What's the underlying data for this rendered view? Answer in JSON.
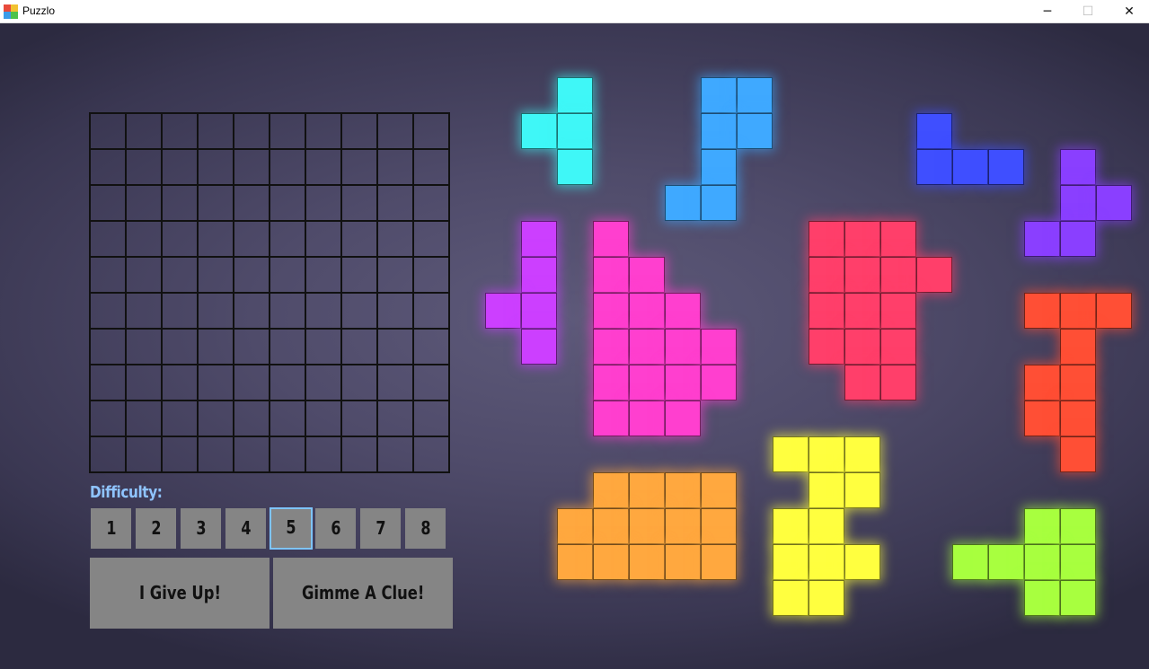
{
  "window": {
    "title": "Puzzlo",
    "minimize_glyph": "─",
    "maximize_glyph": "☐",
    "close_glyph": "✕",
    "icon": "puzzlo-app-icon"
  },
  "board": {
    "rows": 10,
    "cols": 10
  },
  "difficulty": {
    "label": "Difficulty:",
    "levels": [
      "1",
      "2",
      "3",
      "4",
      "5",
      "6",
      "7",
      "8"
    ],
    "selected": "5"
  },
  "actions": {
    "give_up": "I Give Up!",
    "clue": "Gimme A Clue!"
  },
  "colors": {
    "background": "#4f4b6a",
    "accent": "#8fc4ff",
    "button": "#858585"
  },
  "pieces": [
    {
      "name": "cyan",
      "color": "#3ff7f7",
      "cells": [
        [
          1,
          0
        ],
        [
          0,
          1
        ],
        [
          1,
          1
        ],
        [
          1,
          2
        ]
      ]
    },
    {
      "name": "sky-blue",
      "color": "#3fa9ff",
      "cells": [
        [
          1,
          0
        ],
        [
          2,
          0
        ],
        [
          1,
          1
        ],
        [
          2,
          1
        ],
        [
          1,
          2
        ],
        [
          0,
          3
        ],
        [
          1,
          3
        ]
      ]
    },
    {
      "name": "blue",
      "color": "#3f4fff",
      "cells": [
        [
          0,
          0
        ],
        [
          0,
          1
        ],
        [
          1,
          1
        ],
        [
          2,
          1
        ]
      ]
    },
    {
      "name": "violet",
      "color": "#8a3fff",
      "cells": [
        [
          1,
          0
        ],
        [
          1,
          1
        ],
        [
          2,
          1
        ],
        [
          0,
          2
        ],
        [
          1,
          2
        ]
      ]
    },
    {
      "name": "purple",
      "color": "#cc3fff",
      "cells": [
        [
          1,
          0
        ],
        [
          1,
          1
        ],
        [
          0,
          2
        ],
        [
          1,
          2
        ],
        [
          1,
          3
        ]
      ]
    },
    {
      "name": "magenta",
      "color": "#ff3fcf",
      "cells": [
        [
          0,
          0
        ],
        [
          0,
          1
        ],
        [
          1,
          1
        ],
        [
          0,
          2
        ],
        [
          1,
          2
        ],
        [
          2,
          2
        ],
        [
          0,
          3
        ],
        [
          1,
          3
        ],
        [
          2,
          3
        ],
        [
          3,
          3
        ],
        [
          0,
          4
        ],
        [
          1,
          4
        ],
        [
          2,
          4
        ],
        [
          3,
          4
        ],
        [
          0,
          5
        ],
        [
          1,
          5
        ],
        [
          2,
          5
        ]
      ]
    },
    {
      "name": "crimson",
      "color": "#ff3f6a",
      "cells": [
        [
          0,
          0
        ],
        [
          1,
          0
        ],
        [
          2,
          0
        ],
        [
          0,
          1
        ],
        [
          1,
          1
        ],
        [
          2,
          1
        ],
        [
          3,
          1
        ],
        [
          0,
          2
        ],
        [
          1,
          2
        ],
        [
          2,
          2
        ],
        [
          0,
          3
        ],
        [
          1,
          3
        ],
        [
          2,
          3
        ],
        [
          1,
          4
        ],
        [
          2,
          4
        ]
      ]
    },
    {
      "name": "orange-red",
      "color": "#ff4f35",
      "cells": [
        [
          0,
          0
        ],
        [
          1,
          0
        ],
        [
          2,
          0
        ],
        [
          1,
          1
        ],
        [
          0,
          2
        ],
        [
          1,
          2
        ],
        [
          0,
          3
        ],
        [
          1,
          3
        ],
        [
          1,
          4
        ]
      ]
    },
    {
      "name": "orange",
      "color": "#ffa83f",
      "cells": [
        [
          1,
          0
        ],
        [
          2,
          0
        ],
        [
          3,
          0
        ],
        [
          4,
          0
        ],
        [
          0,
          1
        ],
        [
          1,
          1
        ],
        [
          2,
          1
        ],
        [
          3,
          1
        ],
        [
          4,
          1
        ],
        [
          0,
          2
        ],
        [
          1,
          2
        ],
        [
          2,
          2
        ],
        [
          3,
          2
        ],
        [
          4,
          2
        ]
      ]
    },
    {
      "name": "yellow",
      "color": "#ffff3f",
      "cells": [
        [
          0,
          0
        ],
        [
          1,
          0
        ],
        [
          2,
          0
        ],
        [
          1,
          1
        ],
        [
          2,
          1
        ],
        [
          0,
          2
        ],
        [
          1,
          2
        ],
        [
          0,
          3
        ],
        [
          1,
          3
        ],
        [
          2,
          3
        ],
        [
          0,
          4
        ],
        [
          1,
          4
        ]
      ]
    },
    {
      "name": "lime",
      "color": "#a8ff3f",
      "cells": [
        [
          2,
          0
        ],
        [
          3,
          0
        ],
        [
          0,
          1
        ],
        [
          1,
          1
        ],
        [
          2,
          1
        ],
        [
          3,
          1
        ],
        [
          2,
          2
        ],
        [
          3,
          2
        ]
      ]
    }
  ]
}
